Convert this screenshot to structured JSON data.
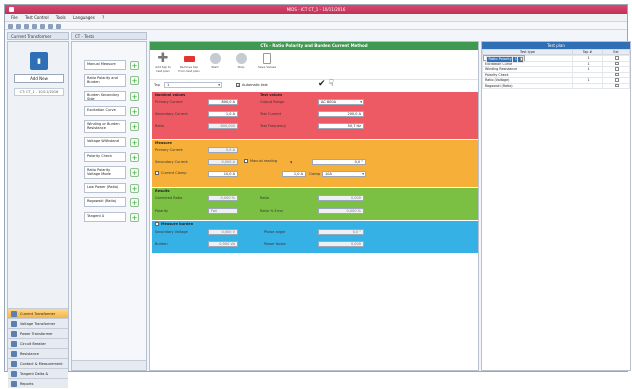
{
  "window": {
    "title": "MIDS - ICT CT_1 - 10/11/2016"
  },
  "menu": [
    "File",
    "Test Control",
    "Tools",
    "Languages",
    "?"
  ],
  "left": {
    "tab": "Current Transformer",
    "add_new": "Add New",
    "ct_item": "CT: CT_1 - 10/11/2016",
    "nav": [
      {
        "label": "Current Transformer",
        "active": true
      },
      {
        "label": "Voltage Transformer",
        "active": false
      },
      {
        "label": "Power Transformer",
        "active": false
      },
      {
        "label": "Circuit Breaker",
        "active": false
      },
      {
        "label": "Resistance",
        "active": false
      },
      {
        "label": "Contact & Measurement",
        "active": false
      },
      {
        "label": "Tangent Delta & Capacitance",
        "active": false
      },
      {
        "label": "Reports",
        "active": false
      }
    ]
  },
  "tests": {
    "tab": "CT - Tests",
    "items": [
      "Manual Measure",
      "Ratio Polarity and Burden",
      "Burden Secondary Side",
      "Excitation Curve",
      "Winding or Burden Resistance",
      "Voltage Withstand",
      "Polarity Check",
      "Ratio Polarity Voltage Mode",
      "Low Power (Ratio)",
      "Rogowski (Ratio)",
      "Tangent δ"
    ]
  },
  "main": {
    "title": "CTs - Ratio Polarity and Burden Current Method",
    "toolbar": [
      "Add tap to test plan",
      "Remove tap from test plan",
      "Start",
      "Stop",
      "Save Values"
    ],
    "tap_label": "Tap",
    "tap_value": "1",
    "auto_test": "Automatic test",
    "nominal": {
      "header": "Nominal values",
      "primary_current_label": "Primary Current",
      "primary_current": "800,0 A",
      "secondary_current_label": "Secondary Current",
      "secondary_current": "1,0 A",
      "ratio_label": "Ratio",
      "ratio": "800,000"
    },
    "test_values": {
      "header": "Test values",
      "output_range_label": "Output Range",
      "output_range": "AC 800A",
      "test_current_label": "Test Current",
      "test_current": "200,0 A",
      "test_frequency_label": "Test Frequency",
      "test_frequency": "50,7 Hz"
    },
    "measure": {
      "header": "Measure",
      "primary_current_label": "Primary Current",
      "primary_current": "0,0 A",
      "secondary_current_label": "Secondary Current",
      "secondary_current": "0,000 A",
      "manual_reading_label": "Manual reading",
      "angle_symbol": "φ",
      "angle_value": "0,0 °",
      "current_clamp_label": "Current Clamp",
      "clamp_value": "10,0 A",
      "clamp_value2": "1,0 A",
      "clamp_select_label": "Clamp",
      "clamp_select": "10A"
    },
    "results": {
      "header": "Results",
      "corrected_ratio_label": "Corrected Ratio",
      "corrected_ratio": "0,000 %",
      "ratio_label": "Ratio",
      "ratio": "0,000",
      "polarity_label": "Polarity",
      "polarity": "Fail",
      "ratio_error_label": "Ratio % Error",
      "ratio_error": "0,000 %"
    },
    "burden": {
      "header": "Measure burden",
      "secondary_voltage_label": "Secondary Voltage",
      "secondary_voltage": "0,000 V",
      "phase_angle_label": "Phase angle",
      "phase_angle": "0,0 °",
      "burden_label": "Burden",
      "burden": "0,000 VA",
      "power_factor_label": "Power factor",
      "power_factor": "0,000"
    }
  },
  "plan": {
    "title": "Test plan",
    "columns": [
      "Test type",
      "Tap #",
      "Ext"
    ],
    "rows": [
      {
        "type": "Ratio Polarity",
        "tap": "1",
        "selected": true
      },
      {
        "type": "Burden Sec. Side",
        "tap": "1",
        "selected": false
      },
      {
        "type": "Excitation Curve",
        "tap": "1",
        "selected": false
      },
      {
        "type": "Winding Resistance",
        "tap": "1",
        "selected": false
      },
      {
        "type": "Polarity Check",
        "tap": "",
        "selected": false
      },
      {
        "type": "Ratio (Voltage)",
        "tap": "1",
        "selected": false
      },
      {
        "type": "Rogowski (Ratio)",
        "tap": "",
        "selected": false
      }
    ]
  }
}
